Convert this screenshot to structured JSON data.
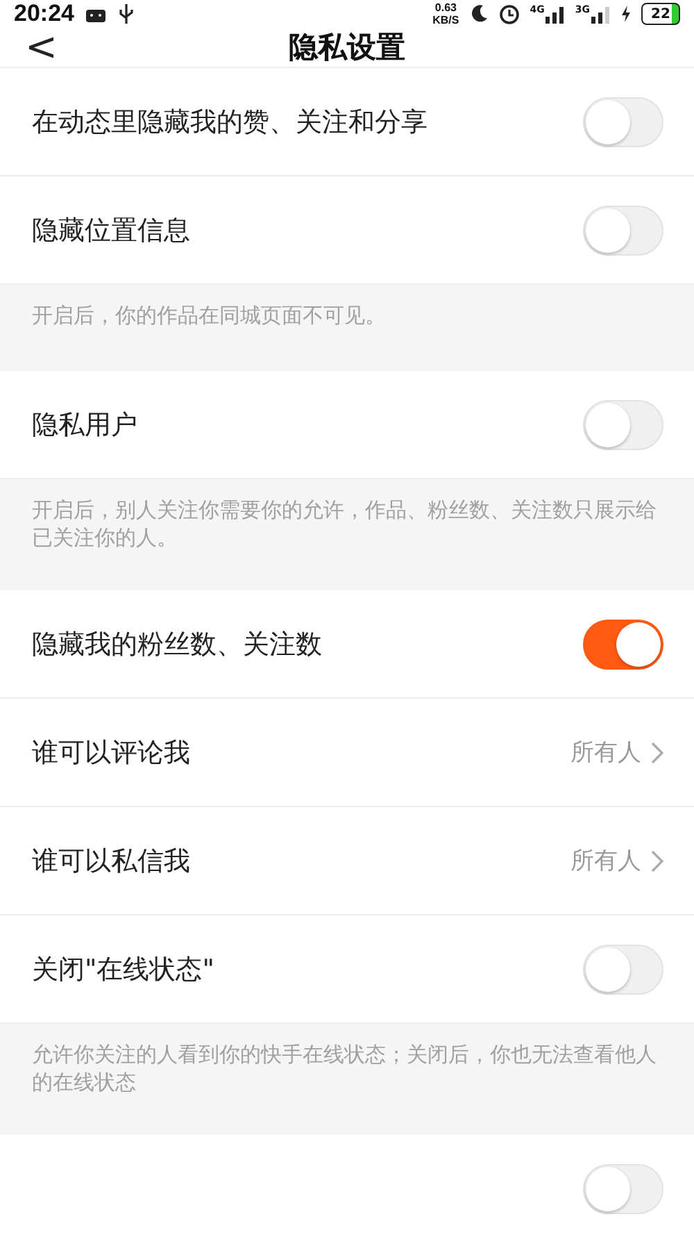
{
  "status_bar": {
    "time": "20:24",
    "speed": "0.63",
    "speed_unit": "KB/S",
    "net_1": "4G",
    "net_2": "3G",
    "battery": "22"
  },
  "header": {
    "back": "<",
    "title": "隐私设置"
  },
  "items": [
    {
      "kind": "toggle",
      "label": "在动态里隐藏我的赞、关注和分享",
      "on": false
    },
    {
      "kind": "toggle",
      "label": "隐藏位置信息",
      "on": false
    },
    {
      "kind": "note",
      "text": "开启后，你的作品在同城页面不可见。"
    },
    {
      "kind": "toggle",
      "label": "隐私用户",
      "on": false
    },
    {
      "kind": "note",
      "text": "开启后，别人关注你需要你的允许，作品、粉丝数、关注数只展示给已关注你的人。"
    },
    {
      "kind": "toggle",
      "label": "隐藏我的粉丝数、关注数",
      "on": true
    },
    {
      "kind": "link",
      "label": "谁可以评论我",
      "value": "所有人"
    },
    {
      "kind": "link",
      "label": "谁可以私信我",
      "value": "所有人"
    },
    {
      "kind": "toggle",
      "label": "关闭\"在线状态\"",
      "on": false
    },
    {
      "kind": "note",
      "text": "允许你关注的人看到你的快手在线状态；关闭后，你也无法查看他人的在线状态"
    },
    {
      "kind": "toggle",
      "on": false
    }
  ]
}
